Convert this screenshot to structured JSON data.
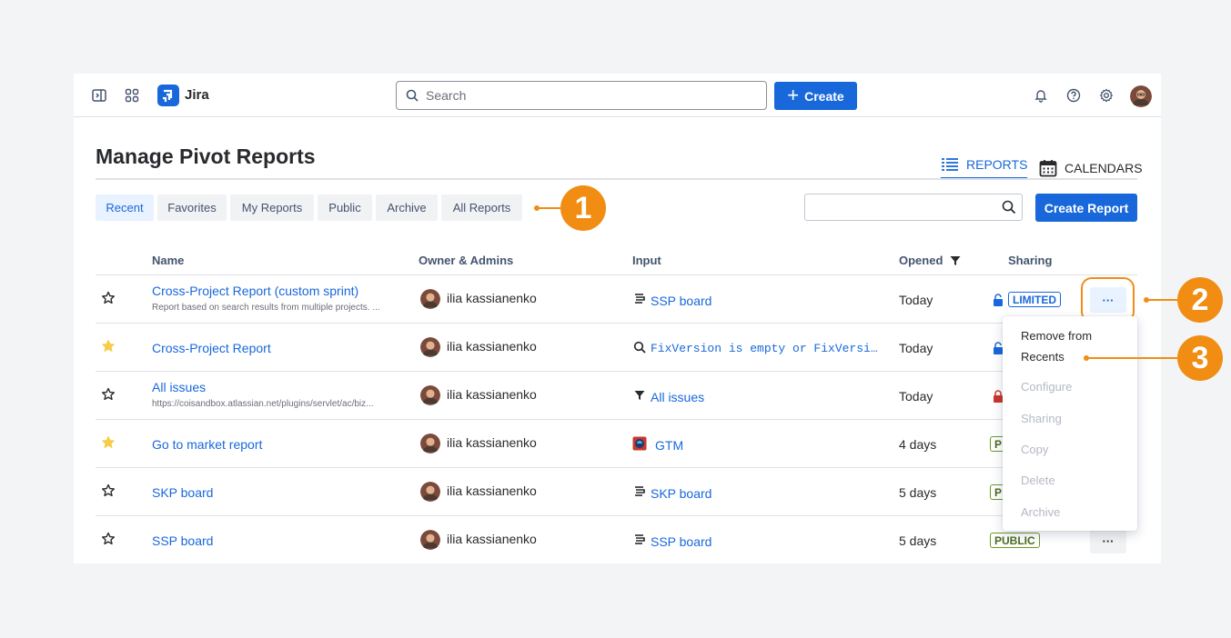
{
  "topbar": {
    "app_name": "Jira",
    "search_placeholder": "Search",
    "create_label": "Create"
  },
  "page": {
    "title": "Manage Pivot Reports",
    "view_tabs": [
      {
        "label": "REPORTS",
        "icon": "list-icon",
        "active": true
      },
      {
        "label": "CALENDARS",
        "icon": "calendar-icon",
        "active": false
      }
    ]
  },
  "filters": {
    "tabs": [
      "Recent",
      "Favorites",
      "My Reports",
      "Public",
      "Archive",
      "All Reports"
    ],
    "active": "Recent",
    "create_report_label": "Create Report"
  },
  "callouts": [
    "1",
    "2",
    "3"
  ],
  "table": {
    "columns": [
      "Name",
      "Owner & Admins",
      "Input",
      "Opened",
      "Sharing"
    ],
    "rows": [
      {
        "starred": false,
        "name": "Cross-Project Report (custom sprint)",
        "description": "Report based on search results from multiple projects. ...",
        "owner": "ilia kassianenko",
        "input_icon": "board-icon",
        "input": "SSP board",
        "opened": "Today",
        "sharing": "LIMITED",
        "lock": "blue"
      },
      {
        "starred": true,
        "name": "Cross-Project Report",
        "description": "",
        "owner": "ilia kassianenko",
        "input_icon": "search-icon",
        "input": "FixVersion is empty or FixVersi…",
        "opened": "Today",
        "sharing": "",
        "lock": "blue"
      },
      {
        "starred": false,
        "name": "All issues",
        "description": "https://coisandbox.atlassian.net/plugins/servlet/ac/biz...",
        "owner": "ilia kassianenko",
        "input_icon": "filter-icon",
        "input": "All issues",
        "opened": "Today",
        "sharing": "",
        "lock": "red"
      },
      {
        "starred": true,
        "name": "Go to market report",
        "description": "",
        "owner": "ilia kassianenko",
        "input_icon": "project-icon",
        "input": "GTM",
        "opened": "4 days",
        "sharing": "P",
        "lock": ""
      },
      {
        "starred": false,
        "name": "SKP board",
        "description": "",
        "owner": "ilia kassianenko",
        "input_icon": "board-icon",
        "input": "SKP board",
        "opened": "5 days",
        "sharing": "P",
        "lock": ""
      },
      {
        "starred": false,
        "name": "SSP board",
        "description": "",
        "owner": "ilia kassianenko",
        "input_icon": "board-icon",
        "input": "SSP board",
        "opened": "5 days",
        "sharing": "PUBLIC",
        "lock": ""
      }
    ],
    "more_label": "···"
  },
  "menu": {
    "items": [
      {
        "label": "Remove from Recents",
        "enabled": true
      },
      {
        "label": "Configure",
        "enabled": false
      },
      {
        "label": "Sharing",
        "enabled": false
      },
      {
        "label": "Copy",
        "enabled": false
      },
      {
        "label": "Delete",
        "enabled": false
      },
      {
        "label": "Archive",
        "enabled": false
      }
    ]
  },
  "colors": {
    "accent": "#1868db",
    "callout": "#f18d13",
    "star_filled": "#f5cd47",
    "lock_blue": "#1868db",
    "lock_red": "#c9372c"
  }
}
